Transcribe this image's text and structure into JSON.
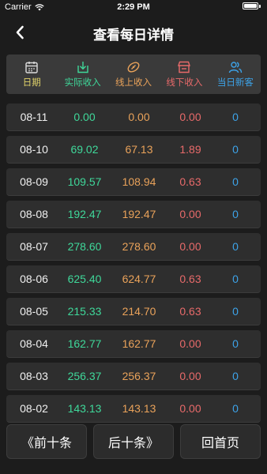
{
  "status": {
    "carrier": "Carrier",
    "time": "2:29 PM"
  },
  "nav": {
    "title": "查看每日详情"
  },
  "columns": [
    {
      "label": "日期",
      "icon": "calendar-icon",
      "color": "#e0d36a"
    },
    {
      "label": "实际收入",
      "icon": "download-icon",
      "color": "#3fd89a"
    },
    {
      "label": "线上收入",
      "icon": "rugby-icon",
      "color": "#e9a25a"
    },
    {
      "label": "线下收入",
      "icon": "store-icon",
      "color": "#e86a6a"
    },
    {
      "label": "当日新客",
      "icon": "users-icon",
      "color": "#3da3e8"
    }
  ],
  "rows": [
    {
      "date": "08-11",
      "actual": "0.00",
      "online": "0.00",
      "offline": "0.00",
      "new": "0"
    },
    {
      "date": "08-10",
      "actual": "69.02",
      "online": "67.13",
      "offline": "1.89",
      "new": "0"
    },
    {
      "date": "08-09",
      "actual": "109.57",
      "online": "108.94",
      "offline": "0.63",
      "new": "0"
    },
    {
      "date": "08-08",
      "actual": "192.47",
      "online": "192.47",
      "offline": "0.00",
      "new": "0"
    },
    {
      "date": "08-07",
      "actual": "278.60",
      "online": "278.60",
      "offline": "0.00",
      "new": "0"
    },
    {
      "date": "08-06",
      "actual": "625.40",
      "online": "624.77",
      "offline": "0.63",
      "new": "0"
    },
    {
      "date": "08-05",
      "actual": "215.33",
      "online": "214.70",
      "offline": "0.63",
      "new": "0"
    },
    {
      "date": "08-04",
      "actual": "162.77",
      "online": "162.77",
      "offline": "0.00",
      "new": "0"
    },
    {
      "date": "08-03",
      "actual": "256.37",
      "online": "256.37",
      "offline": "0.00",
      "new": "0"
    },
    {
      "date": "08-02",
      "actual": "143.13",
      "online": "143.13",
      "offline": "0.00",
      "new": "0"
    }
  ],
  "footer": {
    "prev": "《前十条",
    "next": "后十条》",
    "home": "回首页"
  }
}
